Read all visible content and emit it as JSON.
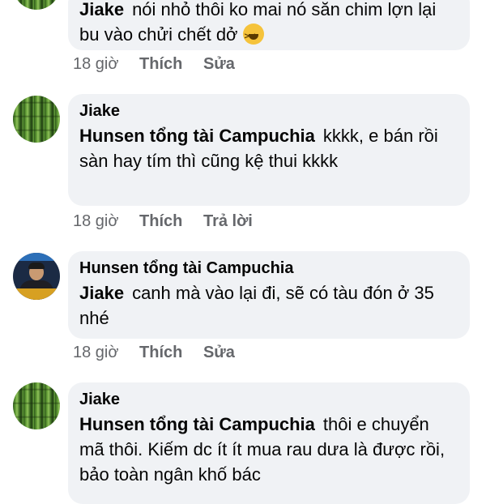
{
  "comments": [
    {
      "author": "Jiake",
      "lines_text": "nói nhỏ thôi ko mai nó săn chim lợn lại bu vào chửi chết dở",
      "emoji": "laughing-squinting-face",
      "time": "18 giờ",
      "like": "Thích",
      "action": "Sửa"
    },
    {
      "author": "Jiake",
      "mention": "Hunsen tổng tài Campuchia",
      "text": "kkkk, e bán rồi sàn hay tím thì cũng kệ thui kkkk",
      "time": "18 giờ",
      "like": "Thích",
      "action": "Trả lời"
    },
    {
      "author": "Hunsen tổng tài Campuchia",
      "mention": "Jiake",
      "text": "canh mà vào lại đi, sẽ có tàu đón ở 35 nhé",
      "time": "18 giờ",
      "like": "Thích",
      "action": "Sửa"
    },
    {
      "author": "Jiake",
      "mention": "Hunsen tổng tài Campuchia",
      "text": "thôi e chuyển  mã thôi. Kiếm dc ít ít mua rau dưa là được rồi, bảo toàn ngân khố bác"
    }
  ]
}
